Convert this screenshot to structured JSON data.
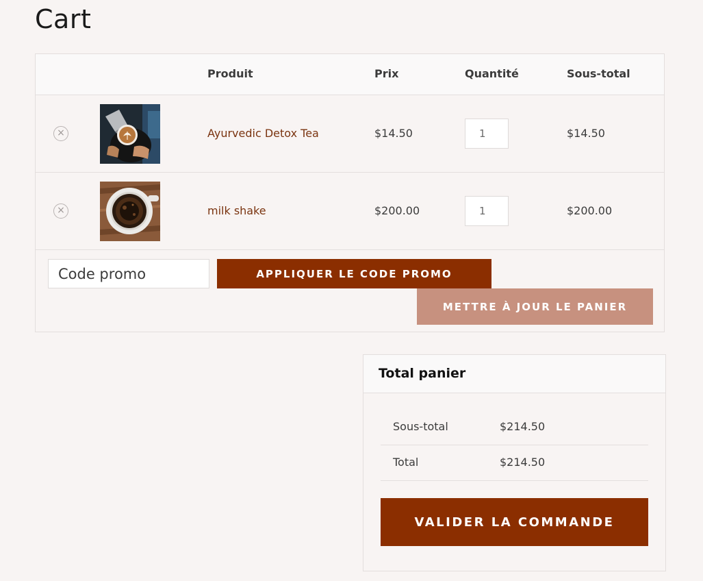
{
  "page": {
    "title": "Cart"
  },
  "table": {
    "headers": {
      "product": "Produit",
      "price": "Prix",
      "quantity": "Quantité",
      "subtotal": "Sous-total"
    },
    "rows": [
      {
        "name": "Ayurvedic Detox Tea",
        "price": "$14.50",
        "quantity": "1",
        "subtotal": "$14.50",
        "image": "latte-art-pour-photo"
      },
      {
        "name": "milk shake",
        "price": "$200.00",
        "quantity": "1",
        "subtotal": "$200.00",
        "image": "black-coffee-cup-photo"
      }
    ],
    "remove_icon": "×"
  },
  "coupon": {
    "placeholder": "Code promo",
    "apply_label": "APPLIQUER LE CODE PROMO",
    "update_label": "METTRE À JOUR LE PANIER"
  },
  "totals": {
    "title": "Total panier",
    "subtotal_label": "Sous-total",
    "subtotal_value": "$214.50",
    "total_label": "Total",
    "total_value": "$214.50",
    "checkout_label": "VALIDER LA COMMANDE"
  },
  "colors": {
    "accent": "#8b2e00",
    "accent_light": "#c7917f",
    "product_link": "#7a3410",
    "background": "#f8f4f3"
  }
}
